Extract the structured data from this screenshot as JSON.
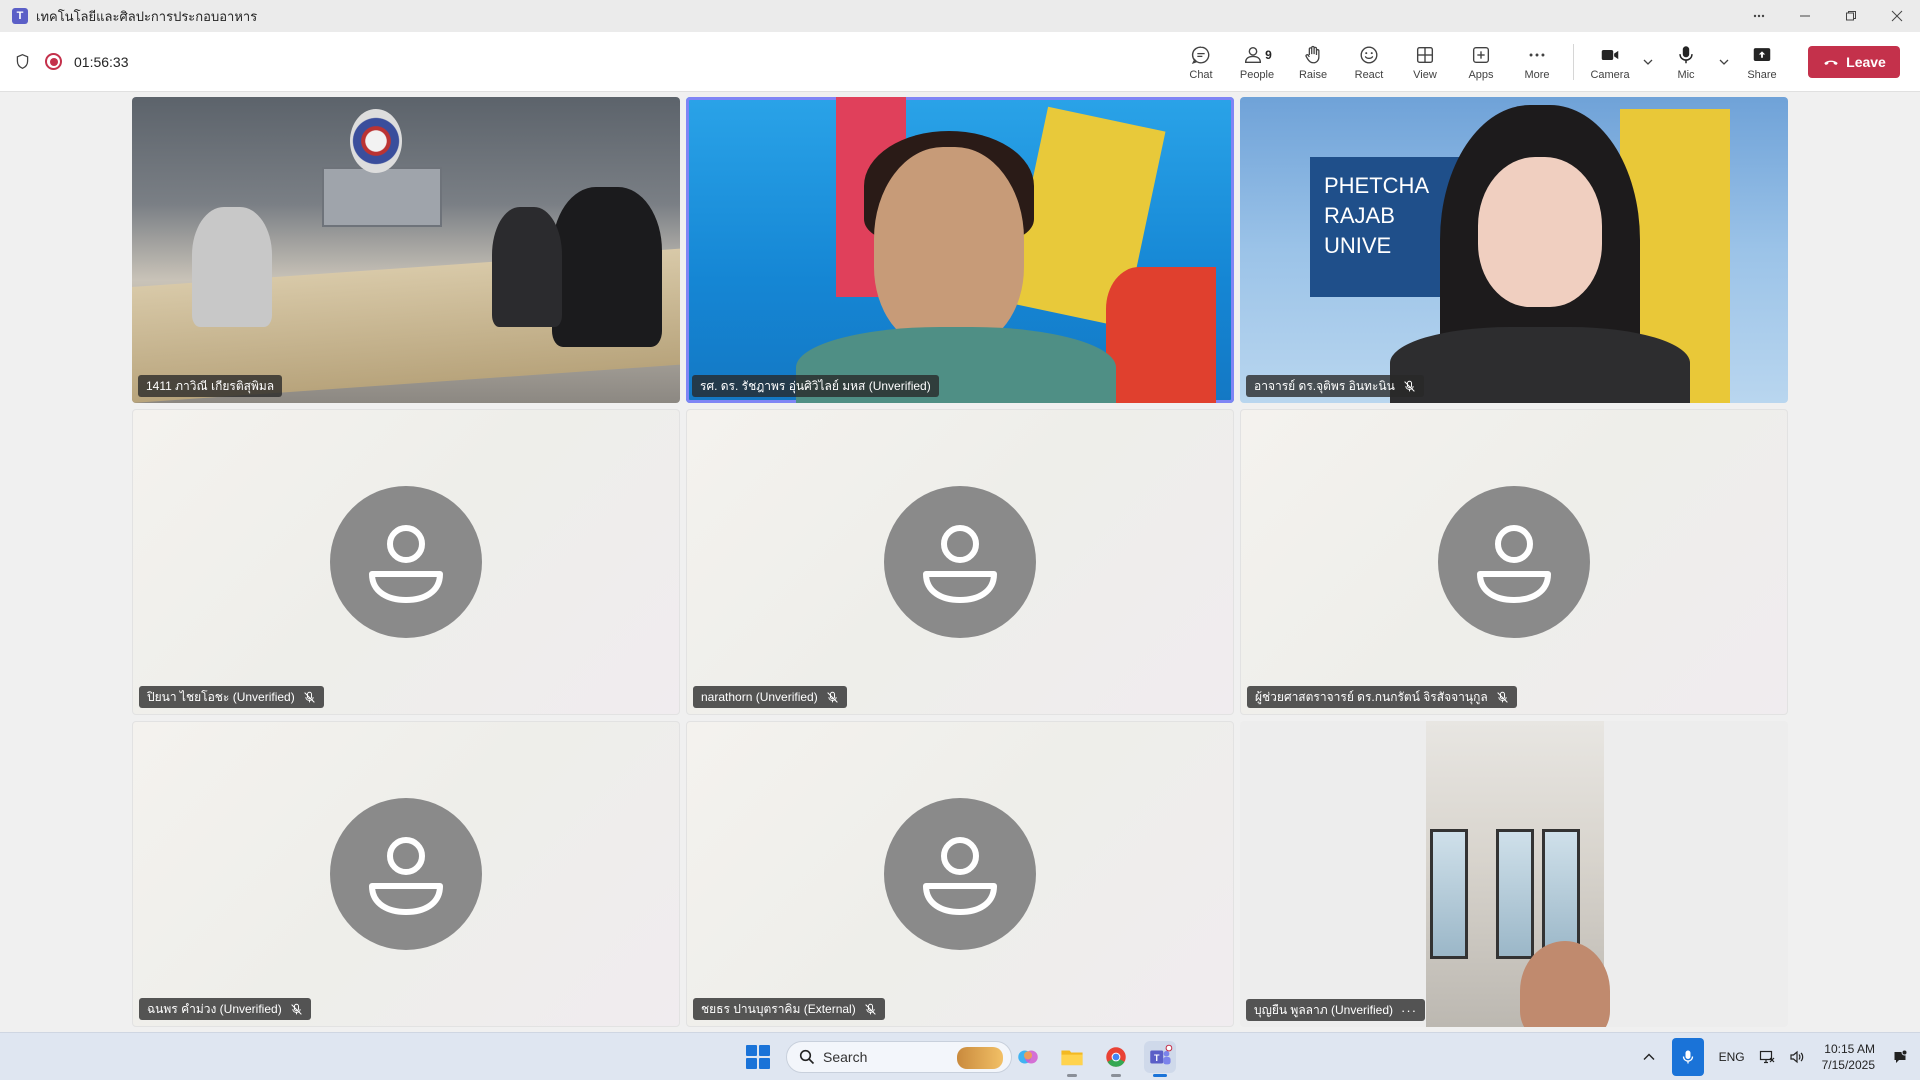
{
  "window": {
    "title": "เทคโนโลยีและศิลปะการประกอบอาหาร",
    "app_logo_letter": "T"
  },
  "meeting": {
    "timer": "01:56:33",
    "people_count": "9",
    "tools": {
      "chat": "Chat",
      "people": "People",
      "raise": "Raise",
      "react": "React",
      "view": "View",
      "apps": "Apps",
      "more": "More",
      "camera": "Camera",
      "mic": "Mic",
      "share": "Share"
    },
    "leave_label": "Leave"
  },
  "participants": [
    {
      "name": "1411 ภาวิณี เกียรติสุพิมล",
      "muted": false,
      "video": true
    },
    {
      "name": "รศ. ดร. รัชฎาพร อุ่นศิวิไลย์ มหส (Unverified)",
      "muted": false,
      "video": true,
      "active": true
    },
    {
      "name": "อาจารย์ ดร.จุติพร อินทะนิน",
      "muted": true,
      "video": true
    },
    {
      "name": "ปิยนา ไชยโอชะ (Unverified)",
      "muted": true,
      "video": false
    },
    {
      "name": "narathorn (Unverified)",
      "muted": true,
      "video": false
    },
    {
      "name": "ผู้ช่วยศาสตราจารย์ ดร.กนกรัตน์ จิรสัจจานุกูล",
      "muted": true,
      "video": false
    },
    {
      "name": "ฉนพร คำม่วง (Unverified)",
      "muted": true,
      "video": false
    },
    {
      "name": "ชยธร ปานบุตราคิม (External)",
      "muted": true,
      "video": false
    },
    {
      "name": "บุญยืน พูลลาภ (Unverified)",
      "muted": false,
      "video": true,
      "more": "···"
    }
  ],
  "scene_text": {
    "banner_line1": "PHETCHA",
    "banner_line2": "RAJAB",
    "banner_line3": "UNIVE"
  },
  "taskbar": {
    "search_placeholder": "Search",
    "language": "ENG",
    "time": "10:15 AM",
    "date": "7/15/2025"
  },
  "colors": {
    "leave": "#c4314b",
    "accent": "#5b5fc7",
    "active_outline": "#7f85f5",
    "taskbar_accent": "#1a73d8"
  }
}
